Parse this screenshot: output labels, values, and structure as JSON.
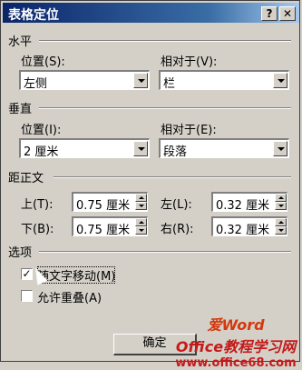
{
  "window": {
    "title": "表格定位",
    "help_label": "?",
    "close_label": "✕"
  },
  "horizontal": {
    "section_label": "水平",
    "position_label": "位置(S):",
    "position_value": "左侧",
    "relative_label": "相对于(V):",
    "relative_value": "栏"
  },
  "vertical": {
    "section_label": "垂直",
    "position_label": "位置(I):",
    "position_value": "2 厘米",
    "relative_label": "相对于(E):",
    "relative_value": "段落"
  },
  "distance": {
    "section_label": "距正文",
    "top_label": "上(T):",
    "top_value": "0.75 厘米",
    "bottom_label": "下(B):",
    "bottom_value": "0.75 厘米",
    "left_label": "左(L):",
    "left_value": "0.32 厘米",
    "right_label": "右(R):",
    "right_value": "0.32 厘米"
  },
  "options": {
    "section_label": "选项",
    "move_with_text_label": "随文字移动(M)",
    "move_with_text_checked": true,
    "allow_overlap_label": "允许重叠(A)",
    "allow_overlap_checked": false,
    "check_mark": "✓"
  },
  "buttons": {
    "ok_label": "确定"
  },
  "watermark": {
    "line1": "爱Word",
    "line2": "Office教程学习网",
    "line3": "www.office68.com"
  }
}
